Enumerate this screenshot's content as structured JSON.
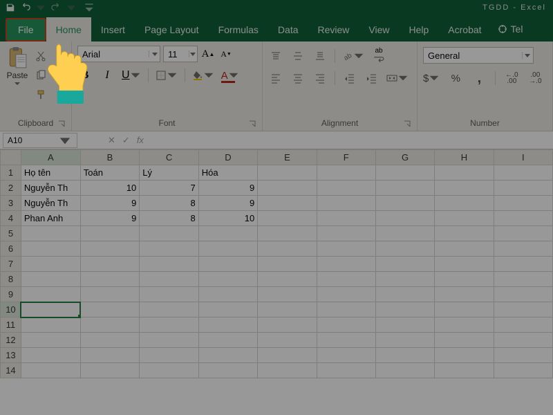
{
  "app": {
    "title": "TGDD  -  Excel"
  },
  "qat": {
    "save": "save",
    "undo": "undo",
    "redo": "redo"
  },
  "tabs": {
    "file": "File",
    "items": [
      "Home",
      "Insert",
      "Page Layout",
      "Formulas",
      "Data",
      "Review",
      "View",
      "Help",
      "Acrobat"
    ],
    "tell": "Tel"
  },
  "ribbon": {
    "clipboard": {
      "paste": "Paste",
      "label": "Clipboard"
    },
    "font": {
      "name": "Arial",
      "size": "11",
      "bold": "B",
      "italic": "I",
      "underline": "U",
      "grow": "A",
      "shrink": "A",
      "fontcolor": "A",
      "label": "Font"
    },
    "alignment": {
      "wrap": "ab",
      "label": "Alignment"
    },
    "number": {
      "format": "General",
      "currency": "$",
      "percent": "%",
      "comma": ",",
      "inc": ".0",
      "dec": ".00",
      "label": "Number"
    }
  },
  "namebox": "A10",
  "fx": {
    "cancel": "✕",
    "enter": "✓",
    "fx": "fx"
  },
  "columns": [
    "A",
    "B",
    "C",
    "D",
    "E",
    "F",
    "G",
    "H",
    "I"
  ],
  "rows": [
    "1",
    "2",
    "3",
    "4",
    "5",
    "6",
    "7",
    "8",
    "9",
    "10",
    "11",
    "12",
    "13",
    "14"
  ],
  "cells": {
    "A1": "Họ tên",
    "B1": "Toán",
    "C1": "Lý",
    "D1": "Hóa",
    "A2": "Nguyễn Th",
    "B2": "10",
    "C2": "7",
    "D2": "9",
    "A3": "Nguyễn Th",
    "B3": "9",
    "C3": "8",
    "D3": "9",
    "A4": "Phan Anh",
    "B4": "9",
    "C4": "8",
    "D4": "10"
  },
  "selected": {
    "row": "10",
    "col": "A"
  }
}
